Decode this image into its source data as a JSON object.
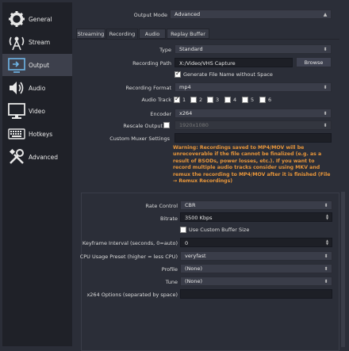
{
  "sidebar": {
    "items": [
      {
        "label": "General",
        "icon": "gear-icon"
      },
      {
        "label": "Stream",
        "icon": "broadcast-icon"
      },
      {
        "label": "Output",
        "icon": "output-icon"
      },
      {
        "label": "Audio",
        "icon": "speaker-icon"
      },
      {
        "label": "Video",
        "icon": "monitor-icon"
      },
      {
        "label": "Hotkeys",
        "icon": "keyboard-icon"
      },
      {
        "label": "Advanced",
        "icon": "tools-icon"
      }
    ],
    "active": "Output"
  },
  "output_mode": {
    "label": "Output Mode",
    "value": "Advanced"
  },
  "tabs": [
    "Streaming",
    "Recording",
    "Audio",
    "Replay Buffer"
  ],
  "active_tab": "Recording",
  "recording": {
    "type_label": "Type",
    "type_value": "Standard",
    "path_label": "Recording Path",
    "path_value": "X:/Video/VHS Capture",
    "browse_label": "Browse",
    "nospace_label": "Generate File Name without Space",
    "format_label": "Recording Format",
    "format_value": "mp4",
    "audio_track_label": "Audio Track",
    "tracks": [
      "1",
      "2",
      "3",
      "4",
      "5",
      "6"
    ],
    "encoder_label": "Encoder",
    "encoder_value": "x264",
    "rescale_label": "Rescale Output",
    "rescale_value": "1920x1080",
    "muxer_label": "Custom Muxer Settings",
    "warning": "Warning: Recordings saved to MP4/MOV will be unrecoverable if the file cannot be finalized (e.g. as a result of BSODs, power losses, etc.). If you want to record multiple audio tracks consider using MKV and remux the recording to MP4/MOV after it is finished (File → Remux Recordings)"
  },
  "encoder_settings": {
    "rate_control_label": "Rate Control",
    "rate_control_value": "CBR",
    "bitrate_label": "Bitrate",
    "bitrate_value": "3500 Kbps",
    "custom_buffer_label": "Use Custom Buffer Size",
    "keyframe_label": "Keyframe Interval (seconds, 0=auto)",
    "keyframe_value": "0",
    "preset_label": "CPU Usage Preset (higher = less CPU)",
    "preset_value": "veryfast",
    "profile_label": "Profile",
    "profile_value": "(None)",
    "tune_label": "Tune",
    "tune_value": "(None)",
    "x264opts_label": "x264 Options (separated by space)",
    "x264opts_value": ""
  }
}
